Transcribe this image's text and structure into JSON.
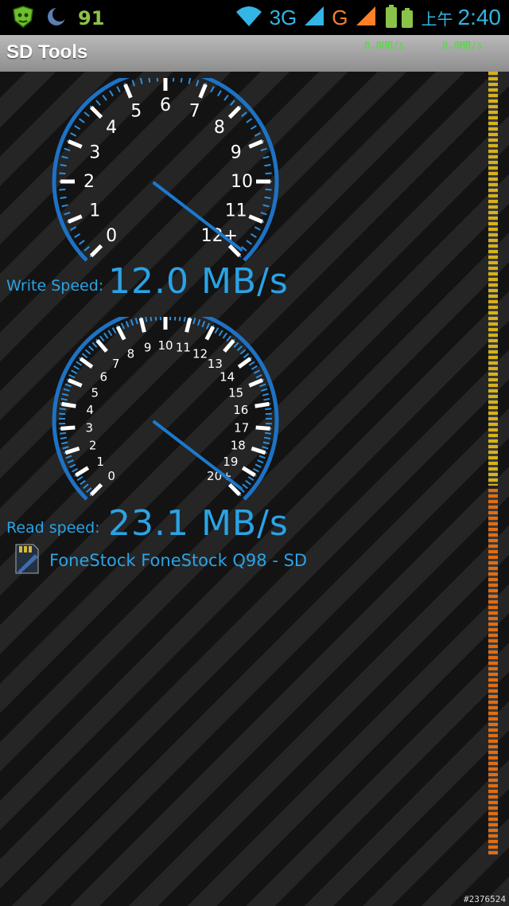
{
  "status_bar": {
    "notification_count": "91",
    "network_3g": "3G",
    "network_g": "G",
    "ampm": "上午",
    "time": "2:40",
    "icons": [
      "shield-app-icon",
      "moon-icon",
      "wifi-icon",
      "signal-icon",
      "battery-icon"
    ]
  },
  "app": {
    "title": "SD Tools",
    "rate_read": "0.0MB/s",
    "rate_write": "0.0MB/s"
  },
  "write_gauge": {
    "label": "Write Speed:",
    "value_text": "12.0 MB/s",
    "value": 12.0,
    "max": 12,
    "ticks": [
      "0",
      "1",
      "2",
      "3",
      "4",
      "5",
      "6",
      "7",
      "8",
      "9",
      "10",
      "11",
      "12+"
    ]
  },
  "read_gauge": {
    "label": "Read speed:",
    "value_text": "23.1 MB/s",
    "value": 23.1,
    "max": 20,
    "ticks": [
      "0",
      "1",
      "2",
      "3",
      "4",
      "5",
      "6",
      "7",
      "8",
      "9",
      "10",
      "11",
      "12",
      "13",
      "14",
      "15",
      "16",
      "17",
      "18",
      "19",
      "20+"
    ]
  },
  "device": {
    "name": "FoneStock FoneStock Q98 - SD",
    "icon": "sd-card-icon"
  },
  "watermark": "#2376524",
  "colors": {
    "accent": "#2aa3e6",
    "status_green": "#4cdc3c",
    "orange": "#ff7f27"
  }
}
